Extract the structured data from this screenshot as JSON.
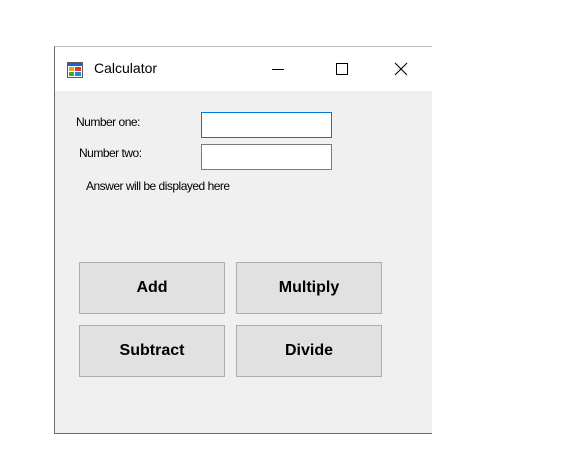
{
  "window": {
    "title": "Calculator",
    "icon": "windows-form-icon",
    "controls": {
      "minimize_icon": "minimize-icon",
      "maximize_icon": "maximize-icon",
      "close_icon": "close-icon"
    }
  },
  "form": {
    "number_one_label": "Number one:",
    "number_one_value": "",
    "number_two_label": "Number two:",
    "number_two_value": "",
    "answer_text": "Answer will be displayed here"
  },
  "buttons": {
    "add": "Add",
    "multiply": "Multiply",
    "subtract": "Subtract",
    "divide": "Divide"
  },
  "colors": {
    "focus_border": "#0078d7",
    "form_background": "#f0f0f0",
    "button_background": "#e1e1e1"
  }
}
